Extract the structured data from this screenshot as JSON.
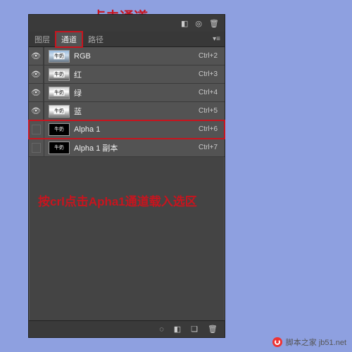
{
  "annotations": {
    "top": "点击通道",
    "mid": "按crl点击Apha1通道载入选区"
  },
  "tabs": {
    "layers": "图层",
    "channels": "通道",
    "paths": "路径"
  },
  "channels": [
    {
      "name": "RGB",
      "shortcut": "Ctrl+2",
      "thumb_label": "牛奶"
    },
    {
      "name": "红",
      "shortcut": "Ctrl+3",
      "thumb_label": "牛奶"
    },
    {
      "name": "绿",
      "shortcut": "Ctrl+4",
      "thumb_label": "牛奶"
    },
    {
      "name": "蓝",
      "shortcut": "Ctrl+5",
      "thumb_label": "牛奶"
    },
    {
      "name": "Alpha 1",
      "shortcut": "Ctrl+6",
      "thumb_label": "牛奶"
    },
    {
      "name": "Alpha 1 副本",
      "shortcut": "Ctrl+7",
      "thumb_label": "牛奶"
    }
  ],
  "watermark": "脚本之家 jb51.net"
}
